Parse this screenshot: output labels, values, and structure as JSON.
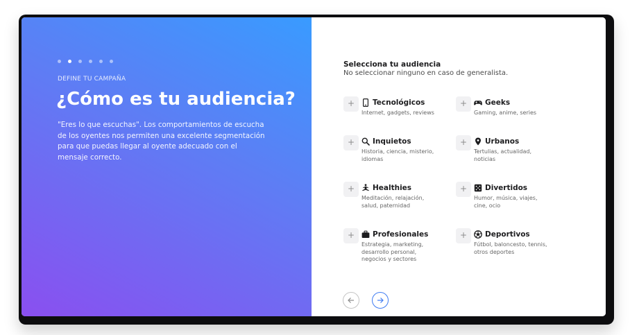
{
  "left": {
    "steps": 6,
    "active_step": 2,
    "kicker": "DEFINE TU CAMPAÑA",
    "headline": "¿Cómo es tu audiencia?",
    "description": "\"Eres lo que escuchas\". Los comportamientos de escucha de los oyentes nos permiten una excelente segmentación para que puedas llegar al oyente adecuado con el mensaje correcto."
  },
  "right": {
    "title": "Selecciona tu audiencia",
    "subtitle": "No seleccionar ninguno en caso de generalista.",
    "options": [
      {
        "label": "Tecnológicos",
        "desc": "Internet, gadgets, reviews",
        "icon": "smartphone-icon"
      },
      {
        "label": "Geeks",
        "desc": "Gaming, anime, series",
        "icon": "gamepad-icon"
      },
      {
        "label": "Inquietos",
        "desc": "Historia, ciencia, misterio, idiomas",
        "icon": "search-icon"
      },
      {
        "label": "Urbanos",
        "desc": "Tertulias, actualidad, noticias",
        "icon": "map-pin-icon"
      },
      {
        "label": "Healthies",
        "desc": "Meditación, relajación, salud, paternidad",
        "icon": "meditation-icon"
      },
      {
        "label": "Divertidos",
        "desc": "Humor, música, viajes, cine, ocio",
        "icon": "dice-icon"
      },
      {
        "label": "Profesionales",
        "desc": "Estrategia, marketing, desarrollo personal, negocios y sectores",
        "icon": "briefcase-icon"
      },
      {
        "label": "Deportivos",
        "desc": "Fútbol, baloncesto, tennis, otros deportes",
        "icon": "soccer-ball-icon"
      }
    ],
    "plus_symbol": "+"
  },
  "colors": {
    "gradient_top": "#399bff",
    "gradient_bottom": "#8a4ff0",
    "accent": "#3e7bf2"
  }
}
